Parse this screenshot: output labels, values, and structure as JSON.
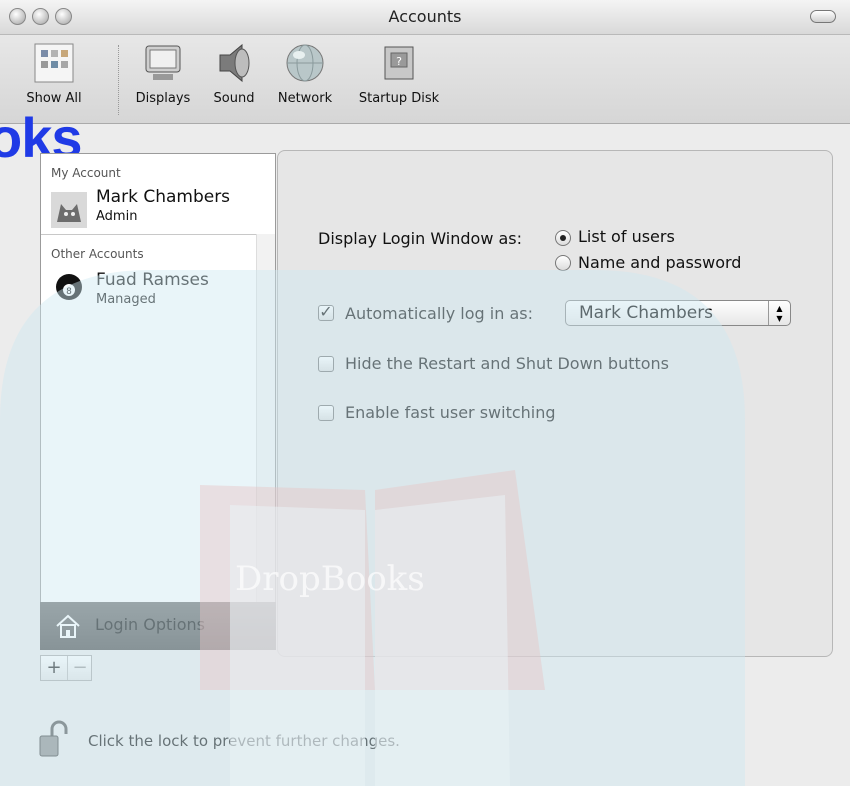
{
  "window": {
    "title": "Accounts"
  },
  "toolbar": {
    "items": [
      {
        "label": "Show All"
      },
      {
        "label": "Displays"
      },
      {
        "label": "Sound"
      },
      {
        "label": "Network"
      },
      {
        "label": "Startup Disk"
      }
    ],
    "overlay_text": "oks"
  },
  "sidebar": {
    "my_account_header": "My Account",
    "my_account": {
      "name": "Mark Chambers",
      "role": "Admin"
    },
    "other_accounts_header": "Other Accounts",
    "other_accounts": [
      {
        "name": "Fuad Ramses",
        "role": "Managed"
      }
    ],
    "login_options_label": "Login Options",
    "add_label": "+",
    "remove_label": "−"
  },
  "panel": {
    "display_login_label": "Display Login Window as:",
    "radio_list_label": "List of users",
    "radio_name_label": "Name and password",
    "auto_login_label": "Automatically log in as:",
    "auto_login_value": "Mark Chambers",
    "hide_restart_label": "Hide the Restart and Shut Down buttons",
    "fast_switching_label": "Enable fast user switching"
  },
  "lock_text": "Click the lock to prevent further changes.",
  "watermark_text": "DropBooks",
  "colors": {
    "overlay_blue": "#1f3ae6",
    "watermark_teal": "#cfe9f2",
    "watermark_red": "#e7c6c6"
  }
}
